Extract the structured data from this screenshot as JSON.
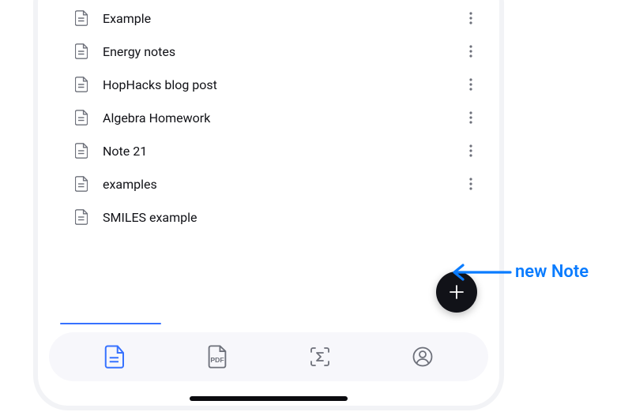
{
  "notes": [
    {
      "title": "Example"
    },
    {
      "title": "Energy notes"
    },
    {
      "title": "HopHacks blog post"
    },
    {
      "title": "Algebra Homework"
    },
    {
      "title": "Note 21"
    },
    {
      "title": "examples"
    },
    {
      "title": "SMILES example"
    }
  ],
  "callout_label": "new Note",
  "colors": {
    "accent": "#3772ff",
    "callout": "#0a7cff",
    "fab_bg": "#111218",
    "icon_inactive": "#6d707a",
    "tabbar_bg": "#f7f7fb"
  }
}
